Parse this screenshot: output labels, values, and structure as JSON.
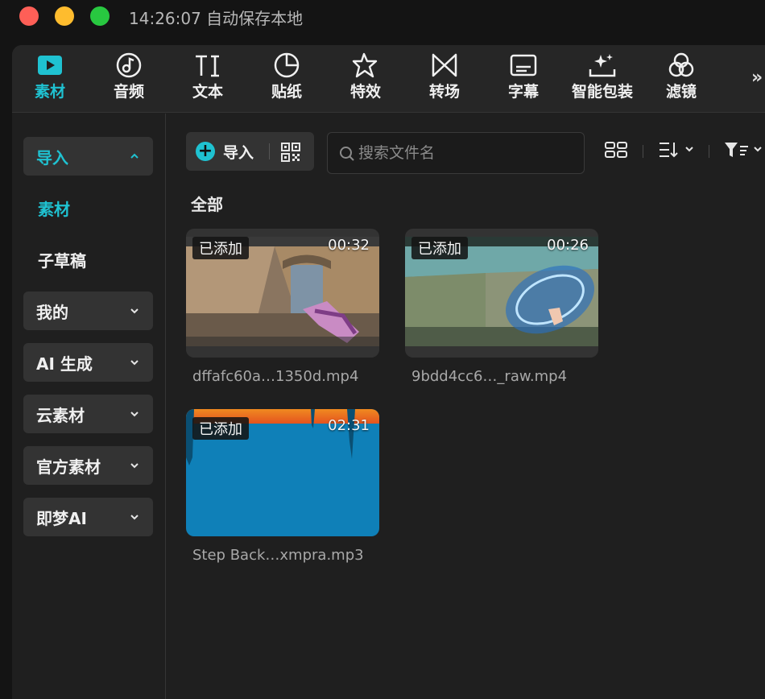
{
  "titlebar": {
    "title": "14:26:07 自动保存本地"
  },
  "toolbar": {
    "tools": [
      {
        "label": "素材",
        "icon": "media-play-icon",
        "active": true
      },
      {
        "label": "音频",
        "icon": "music-note-icon"
      },
      {
        "label": "文本",
        "icon": "text-icon"
      },
      {
        "label": "贴纸",
        "icon": "sticker-icon"
      },
      {
        "label": "特效",
        "icon": "sparkle-star-icon"
      },
      {
        "label": "转场",
        "icon": "transition-icon"
      },
      {
        "label": "字幕",
        "icon": "subtitle-icon"
      },
      {
        "label": "智能包装",
        "icon": "magic-wand-icon"
      },
      {
        "label": "滤镜",
        "icon": "filter-rings-icon"
      }
    ],
    "more_label": "»"
  },
  "sidebar": {
    "import": {
      "label": "导入"
    },
    "sub_items": [
      {
        "label": "素材",
        "active": true
      },
      {
        "label": "子草稿"
      }
    ],
    "groups": [
      {
        "label": "我的"
      },
      {
        "label": "AI 生成"
      },
      {
        "label": "云素材"
      },
      {
        "label": "官方素材"
      },
      {
        "label": "即梦AI"
      }
    ]
  },
  "main": {
    "import_label": "导入",
    "search": {
      "placeholder": "搜索文件名",
      "value": ""
    },
    "section_title": "全部",
    "items": [
      {
        "badge": "已添加",
        "duration": "00:32",
        "filename": "dffafc60a…1350d.mp4",
        "type": "video"
      },
      {
        "badge": "已添加",
        "duration": "00:26",
        "filename": "9bdd4cc6…_raw.mp4",
        "type": "video"
      },
      {
        "badge": "已添加",
        "duration": "02:31",
        "filename": "Step Back…xmpra.mp3",
        "type": "audio"
      }
    ]
  },
  "colors": {
    "accent": "#1fc2d1",
    "background": "#1f1f1f",
    "panel": "#262626",
    "audio_blue": "#0f80b8",
    "audio_orange": "#ee6b20"
  }
}
